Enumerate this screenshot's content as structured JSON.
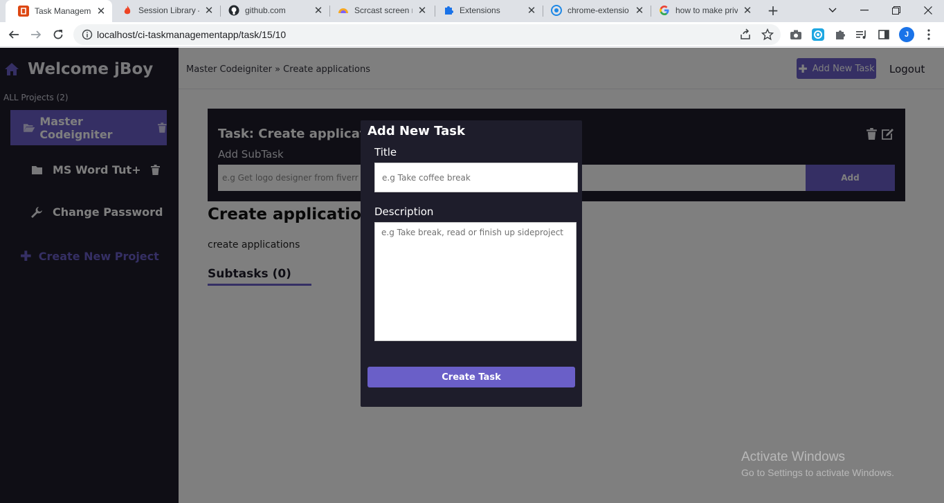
{
  "browser": {
    "tabs": [
      {
        "title": "Task Management",
        "icon": "codeigniter-icon",
        "color": "#dd4814"
      },
      {
        "title": "Session Library —",
        "icon": "flame-icon",
        "color": "#ee4323"
      },
      {
        "title": "github.com",
        "icon": "github-icon",
        "color": "#24292e"
      },
      {
        "title": "Scrcast screen re",
        "icon": "scrcast-icon",
        "color": "#f5a623"
      },
      {
        "title": "Extensions",
        "icon": "puzzle-icon",
        "color": "#1a73e8"
      },
      {
        "title": "chrome-extensio",
        "icon": "extension-icon",
        "color": "#1e88e5"
      },
      {
        "title": "how to make priv",
        "icon": "google-icon",
        "color": "#4285f4"
      }
    ],
    "url": "localhost/ci-taskmanagementapp/task/15/10",
    "profile_initial": "J"
  },
  "sidebar": {
    "welcome": "Welcome jBoy",
    "all_projects": "ALL Projects (2)",
    "projects": [
      {
        "name": "Master Codeigniter"
      },
      {
        "name": "MS Word Tut+"
      }
    ],
    "change_password": "Change Password",
    "create_project": "Create New Project"
  },
  "header": {
    "breadcrumb": "Master Codeigniter » Create applications",
    "add_task": "Add New Task",
    "logout": "Logout"
  },
  "task": {
    "title": "Task: Create applications",
    "add_subtask_label": "Add SubTask",
    "subtask_placeholder": "e.g Get logo designer from fiverr",
    "add_button": "Add",
    "heading": "Create applications",
    "description": "create applications",
    "subtasks_heading": "Subtasks (0)"
  },
  "modal": {
    "title": "Add New Task",
    "title_label": "Title",
    "title_placeholder": "e.g Take coffee break",
    "description_label": "Description",
    "description_placeholder": "e.g Take break, read or finish up sideproject",
    "submit": "Create Task"
  },
  "watermark": {
    "title": "Activate Windows",
    "subtitle": "Go to Settings to activate Windows."
  },
  "colors": {
    "accent": "#6a5fc8",
    "dark": "#1e1d2b"
  }
}
